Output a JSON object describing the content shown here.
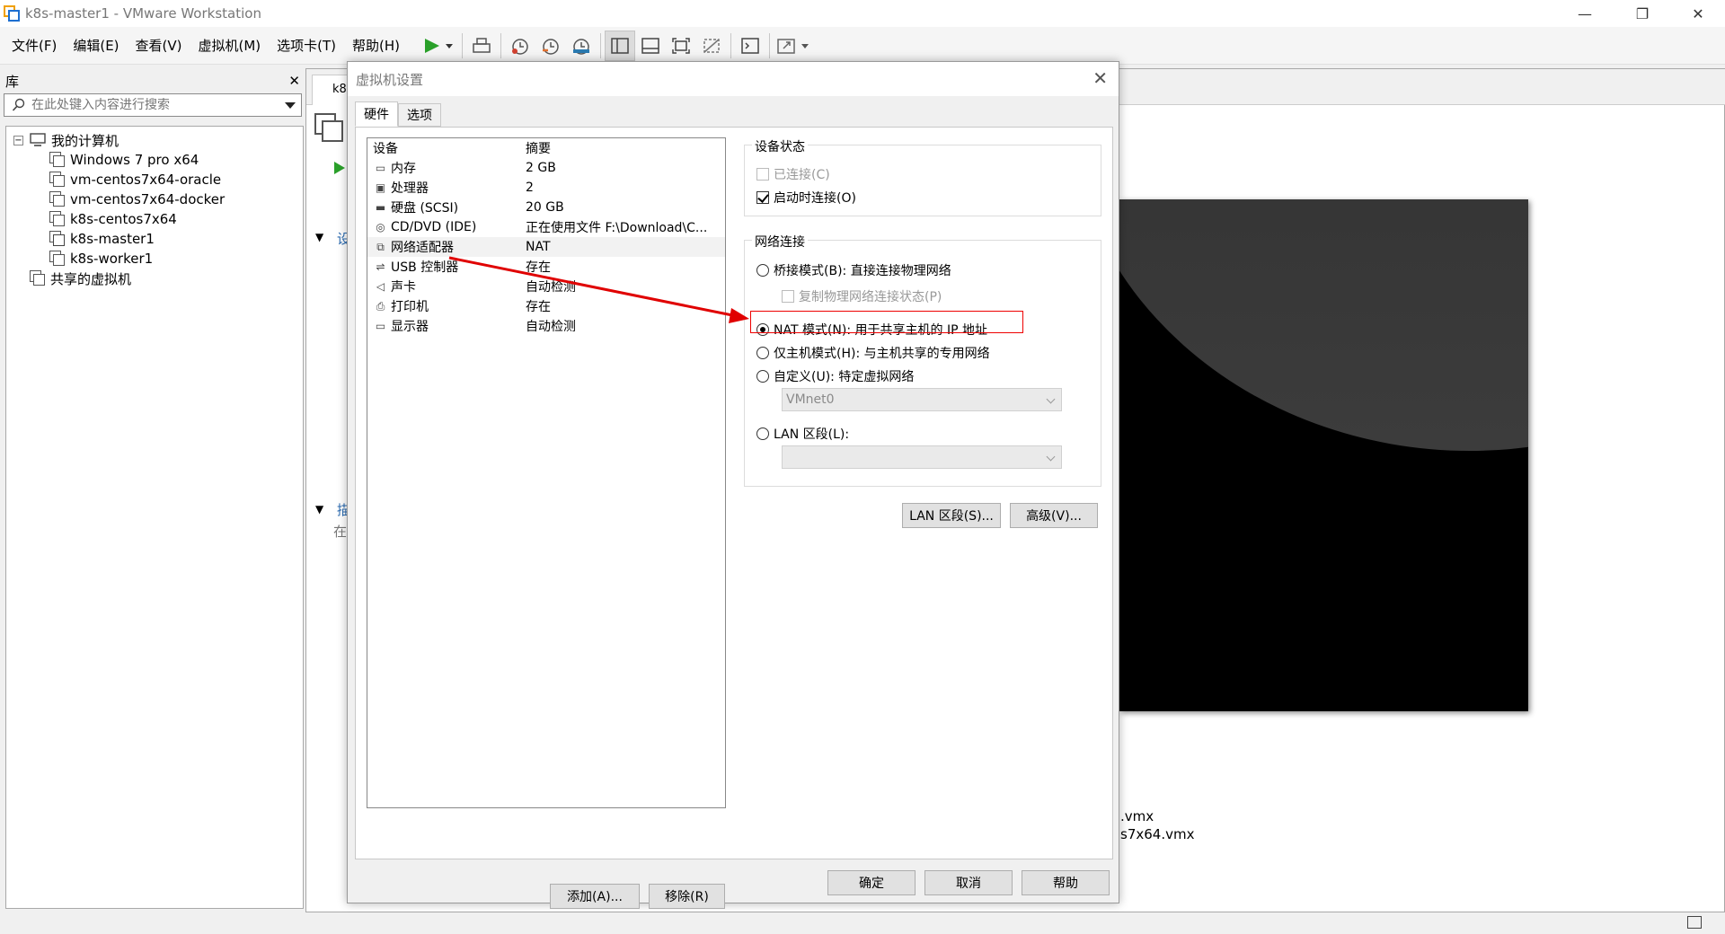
{
  "window": {
    "title": "k8s-master1 - VMware Workstation"
  },
  "menu": [
    "文件(F)",
    "编辑(E)",
    "查看(V)",
    "虚拟机(M)",
    "选项卡(T)",
    "帮助(H)"
  ],
  "library": {
    "title": "库",
    "search_placeholder": "在此处键入内容进行搜索",
    "root": "我的计算机",
    "vms": [
      "Windows 7 pro x64",
      "vm-centos7x64-oracle",
      "vm-centos7x64-docker",
      "k8s-centos7x64",
      "k8s-master1",
      "k8s-worker1"
    ],
    "shared": "共享的虚拟机"
  },
  "workspace": {
    "tab_prefix": "k8",
    "section1": "设",
    "section2": "描",
    "section2_text": "在",
    "vmx_line1": ".vmx",
    "vmx_line2": "s7x64.vmx"
  },
  "dialog": {
    "title": "虚拟机设置",
    "tabs": [
      "硬件",
      "选项"
    ],
    "columns": {
      "device": "设备",
      "summary": "摘要"
    },
    "devices": [
      {
        "name": "内存",
        "summary": "2 GB",
        "icon": "memory-icon",
        "glyph": "▭"
      },
      {
        "name": "处理器",
        "summary": "2",
        "icon": "cpu-icon",
        "glyph": "▣"
      },
      {
        "name": "硬盘 (SCSI)",
        "summary": "20 GB",
        "icon": "harddisk-icon",
        "glyph": "▬"
      },
      {
        "name": "CD/DVD (IDE)",
        "summary": "正在使用文件 F:\\Download\\C...",
        "icon": "cdrom-icon",
        "glyph": "◎"
      },
      {
        "name": "网络适配器",
        "summary": "NAT",
        "icon": "network-adapter-icon",
        "glyph": "⧉"
      },
      {
        "name": "USB 控制器",
        "summary": "存在",
        "icon": "usb-icon",
        "glyph": "⇌"
      },
      {
        "name": "声卡",
        "summary": "自动检测",
        "icon": "sound-icon",
        "glyph": "◁"
      },
      {
        "name": "打印机",
        "summary": "存在",
        "icon": "printer-icon",
        "glyph": "⎙"
      },
      {
        "name": "显示器",
        "summary": "自动检测",
        "icon": "monitor-icon",
        "glyph": "▭"
      }
    ],
    "add_button": "添加(A)...",
    "remove_button": "移除(R)",
    "device_status": {
      "label": "设备状态",
      "connected": "已连接(C)",
      "connect_on_power": "启动时连接(O)"
    },
    "network": {
      "label": "网络连接",
      "bridged": "桥接模式(B): 直接连接物理网络",
      "replicate": "复制物理网络连接状态(P)",
      "nat": "NAT 模式(N): 用于共享主机的 IP 地址",
      "host_only": "仅主机模式(H): 与主机共享的专用网络",
      "custom": "自定义(U): 特定虚拟网络",
      "custom_value": "VMnet0",
      "lan": "LAN 区段(L):",
      "lan_value": ""
    },
    "lan_segments_button": "LAN 区段(S)...",
    "advanced_button": "高级(V)...",
    "ok_button": "确定",
    "cancel_button": "取消",
    "help_button": "帮助"
  },
  "colors": {
    "highlight": "#e00000",
    "play_green": "#2aa02a",
    "vm_screen": "#000000"
  }
}
